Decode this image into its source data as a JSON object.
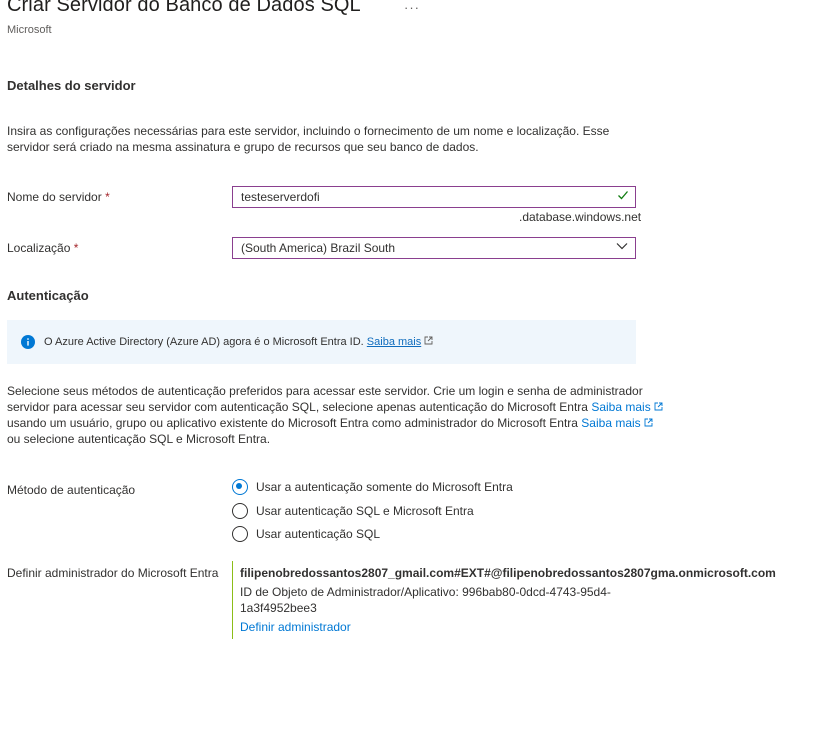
{
  "header": {
    "title": "Criar Servidor do Banco de Dados SQL",
    "ellipsis": "···",
    "publisher": "Microsoft"
  },
  "server_details": {
    "section_title": "Detalhes do servidor",
    "description": "Insira as configurações necessárias para este servidor, incluindo o fornecimento de um nome e localização. Esse servidor será criado na mesma assinatura e grupo de recursos que seu banco de dados.",
    "server_name_label": "Nome do servidor",
    "server_name_value": "testeserverdofi",
    "server_name_suffix": ".database.windows.net",
    "location_label": "Localização",
    "location_value": "(South America) Brazil South",
    "required_mark": "*"
  },
  "authentication": {
    "section_title": "Autenticação",
    "info_text": "O Azure Active Directory (Azure AD) agora é o Microsoft Entra ID.",
    "info_link": "Saiba mais",
    "desc_line1": "Selecione seus métodos de autenticação preferidos para acessar este servidor. Crie um login e senha de administrador",
    "desc_line2": "servidor para acessar seu servidor com autenticação SQL, selecione apenas autenticação do Microsoft Entra",
    "desc_line3": "usando um usuário, grupo ou aplicativo existente do Microsoft Entra como administrador do Microsoft Entra",
    "desc_line4": "ou selecione autenticação SQL e Microsoft Entra.",
    "learn_more": "Saiba mais",
    "method_label": "Método de autenticação",
    "options": [
      {
        "label": "Usar a autenticação somente do Microsoft Entra",
        "selected": true
      },
      {
        "label": "Usar autenticação SQL e Microsoft Entra",
        "selected": false
      },
      {
        "label": "Usar autenticação SQL",
        "selected": false
      }
    ],
    "admin_label": "Definir administrador do Microsoft Entra",
    "admin_account": "filipenobredossantos2807_gmail.com#EXT#@filipenobredossantos2807gma.onmicrosoft.com",
    "admin_id_line1": "ID de Objeto de Administrador/Aplicativo: 996bab80-0dcd-4743-95d4-",
    "admin_id_line2": "1a3f4952bee3",
    "set_admin_link": "Definir administrador"
  },
  "colors": {
    "accent": "#0078d4",
    "required": "#a4262c",
    "input_border": "#8a3f8f",
    "valid_check": "#107c10",
    "info_bg": "#eff6fc",
    "admin_bar": "#8cbd18"
  },
  "icons": [
    "ellipsis-icon",
    "checkmark-icon",
    "chevron-down-icon",
    "info-icon",
    "external-link-icon"
  ]
}
